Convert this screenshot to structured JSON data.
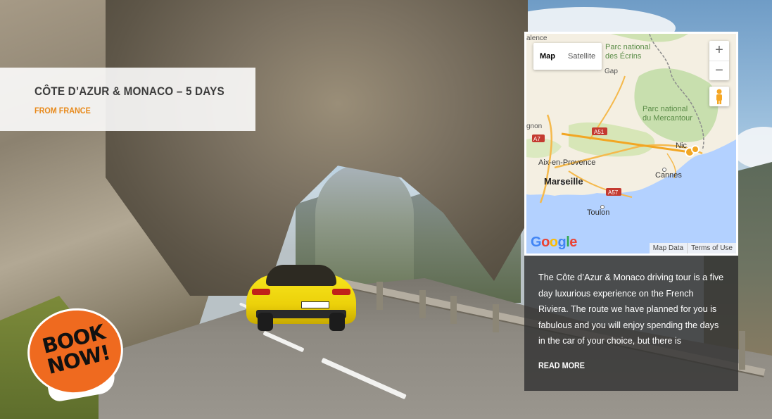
{
  "tour": {
    "title": "CÔTE D’AZUR & MONACO – 5 DAYS",
    "subtitle": "FROM FRANCE"
  },
  "map": {
    "type_buttons": [
      "Map",
      "Satellite"
    ],
    "zoom_in": "+",
    "zoom_out": "−",
    "labels": {
      "valence": "alence",
      "ecrins_1": "Parc national",
      "ecrins_2": "des Écrins",
      "gap": "Gap",
      "mercantour_1": "Parc national",
      "mercantour_2": "du Mercantour",
      "avignon": "gnon",
      "a7": "A7",
      "a51": "A51",
      "a8": "A8",
      "a57": "A57",
      "nice": "Nic",
      "aix": "Aix-en-Provence",
      "cannes": "Cannes",
      "marseille": "Marseille",
      "toulon": "Toulon"
    },
    "google": [
      "G",
      "o",
      "o",
      "g",
      "l",
      "e"
    ],
    "footer": [
      "Map Data",
      "Terms of Use"
    ]
  },
  "description": {
    "text": "The Côte d’Azur & Monaco driving tour is a five day luxurious experience on the French Riviera. The route we have planned for you is fabulous and you will enjoy spending the days in the car of your choice, but there is",
    "read_more": "READ MORE"
  },
  "badge": {
    "line1": "BOOK",
    "line2": "NOW!"
  },
  "car": {
    "plate": "S-PO 4046"
  },
  "colors": {
    "accent": "#e8891a",
    "badge": "#ef6a1f",
    "route": "#f2a623"
  }
}
